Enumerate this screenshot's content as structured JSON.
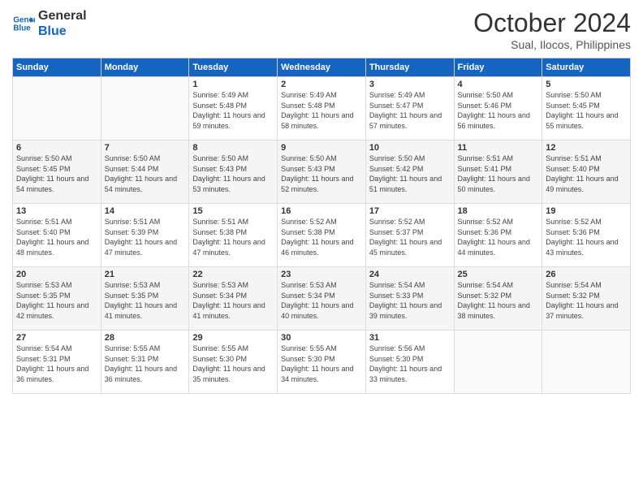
{
  "logo": {
    "line1": "General",
    "line2": "Blue"
  },
  "title": "October 2024",
  "location": "Sual, Ilocos, Philippines",
  "days_of_week": [
    "Sunday",
    "Monday",
    "Tuesday",
    "Wednesday",
    "Thursday",
    "Friday",
    "Saturday"
  ],
  "weeks": [
    [
      {
        "day": "",
        "sunrise": "",
        "sunset": "",
        "daylight": ""
      },
      {
        "day": "",
        "sunrise": "",
        "sunset": "",
        "daylight": ""
      },
      {
        "day": "1",
        "sunrise": "Sunrise: 5:49 AM",
        "sunset": "Sunset: 5:48 PM",
        "daylight": "Daylight: 11 hours and 59 minutes."
      },
      {
        "day": "2",
        "sunrise": "Sunrise: 5:49 AM",
        "sunset": "Sunset: 5:48 PM",
        "daylight": "Daylight: 11 hours and 58 minutes."
      },
      {
        "day": "3",
        "sunrise": "Sunrise: 5:49 AM",
        "sunset": "Sunset: 5:47 PM",
        "daylight": "Daylight: 11 hours and 57 minutes."
      },
      {
        "day": "4",
        "sunrise": "Sunrise: 5:50 AM",
        "sunset": "Sunset: 5:46 PM",
        "daylight": "Daylight: 11 hours and 56 minutes."
      },
      {
        "day": "5",
        "sunrise": "Sunrise: 5:50 AM",
        "sunset": "Sunset: 5:45 PM",
        "daylight": "Daylight: 11 hours and 55 minutes."
      }
    ],
    [
      {
        "day": "6",
        "sunrise": "Sunrise: 5:50 AM",
        "sunset": "Sunset: 5:45 PM",
        "daylight": "Daylight: 11 hours and 54 minutes."
      },
      {
        "day": "7",
        "sunrise": "Sunrise: 5:50 AM",
        "sunset": "Sunset: 5:44 PM",
        "daylight": "Daylight: 11 hours and 54 minutes."
      },
      {
        "day": "8",
        "sunrise": "Sunrise: 5:50 AM",
        "sunset": "Sunset: 5:43 PM",
        "daylight": "Daylight: 11 hours and 53 minutes."
      },
      {
        "day": "9",
        "sunrise": "Sunrise: 5:50 AM",
        "sunset": "Sunset: 5:43 PM",
        "daylight": "Daylight: 11 hours and 52 minutes."
      },
      {
        "day": "10",
        "sunrise": "Sunrise: 5:50 AM",
        "sunset": "Sunset: 5:42 PM",
        "daylight": "Daylight: 11 hours and 51 minutes."
      },
      {
        "day": "11",
        "sunrise": "Sunrise: 5:51 AM",
        "sunset": "Sunset: 5:41 PM",
        "daylight": "Daylight: 11 hours and 50 minutes."
      },
      {
        "day": "12",
        "sunrise": "Sunrise: 5:51 AM",
        "sunset": "Sunset: 5:40 PM",
        "daylight": "Daylight: 11 hours and 49 minutes."
      }
    ],
    [
      {
        "day": "13",
        "sunrise": "Sunrise: 5:51 AM",
        "sunset": "Sunset: 5:40 PM",
        "daylight": "Daylight: 11 hours and 48 minutes."
      },
      {
        "day": "14",
        "sunrise": "Sunrise: 5:51 AM",
        "sunset": "Sunset: 5:39 PM",
        "daylight": "Daylight: 11 hours and 47 minutes."
      },
      {
        "day": "15",
        "sunrise": "Sunrise: 5:51 AM",
        "sunset": "Sunset: 5:38 PM",
        "daylight": "Daylight: 11 hours and 47 minutes."
      },
      {
        "day": "16",
        "sunrise": "Sunrise: 5:52 AM",
        "sunset": "Sunset: 5:38 PM",
        "daylight": "Daylight: 11 hours and 46 minutes."
      },
      {
        "day": "17",
        "sunrise": "Sunrise: 5:52 AM",
        "sunset": "Sunset: 5:37 PM",
        "daylight": "Daylight: 11 hours and 45 minutes."
      },
      {
        "day": "18",
        "sunrise": "Sunrise: 5:52 AM",
        "sunset": "Sunset: 5:36 PM",
        "daylight": "Daylight: 11 hours and 44 minutes."
      },
      {
        "day": "19",
        "sunrise": "Sunrise: 5:52 AM",
        "sunset": "Sunset: 5:36 PM",
        "daylight": "Daylight: 11 hours and 43 minutes."
      }
    ],
    [
      {
        "day": "20",
        "sunrise": "Sunrise: 5:53 AM",
        "sunset": "Sunset: 5:35 PM",
        "daylight": "Daylight: 11 hours and 42 minutes."
      },
      {
        "day": "21",
        "sunrise": "Sunrise: 5:53 AM",
        "sunset": "Sunset: 5:35 PM",
        "daylight": "Daylight: 11 hours and 41 minutes."
      },
      {
        "day": "22",
        "sunrise": "Sunrise: 5:53 AM",
        "sunset": "Sunset: 5:34 PM",
        "daylight": "Daylight: 11 hours and 41 minutes."
      },
      {
        "day": "23",
        "sunrise": "Sunrise: 5:53 AM",
        "sunset": "Sunset: 5:34 PM",
        "daylight": "Daylight: 11 hours and 40 minutes."
      },
      {
        "day": "24",
        "sunrise": "Sunrise: 5:54 AM",
        "sunset": "Sunset: 5:33 PM",
        "daylight": "Daylight: 11 hours and 39 minutes."
      },
      {
        "day": "25",
        "sunrise": "Sunrise: 5:54 AM",
        "sunset": "Sunset: 5:32 PM",
        "daylight": "Daylight: 11 hours and 38 minutes."
      },
      {
        "day": "26",
        "sunrise": "Sunrise: 5:54 AM",
        "sunset": "Sunset: 5:32 PM",
        "daylight": "Daylight: 11 hours and 37 minutes."
      }
    ],
    [
      {
        "day": "27",
        "sunrise": "Sunrise: 5:54 AM",
        "sunset": "Sunset: 5:31 PM",
        "daylight": "Daylight: 11 hours and 36 minutes."
      },
      {
        "day": "28",
        "sunrise": "Sunrise: 5:55 AM",
        "sunset": "Sunset: 5:31 PM",
        "daylight": "Daylight: 11 hours and 36 minutes."
      },
      {
        "day": "29",
        "sunrise": "Sunrise: 5:55 AM",
        "sunset": "Sunset: 5:30 PM",
        "daylight": "Daylight: 11 hours and 35 minutes."
      },
      {
        "day": "30",
        "sunrise": "Sunrise: 5:55 AM",
        "sunset": "Sunset: 5:30 PM",
        "daylight": "Daylight: 11 hours and 34 minutes."
      },
      {
        "day": "31",
        "sunrise": "Sunrise: 5:56 AM",
        "sunset": "Sunset: 5:30 PM",
        "daylight": "Daylight: 11 hours and 33 minutes."
      },
      {
        "day": "",
        "sunrise": "",
        "sunset": "",
        "daylight": ""
      },
      {
        "day": "",
        "sunrise": "",
        "sunset": "",
        "daylight": ""
      }
    ]
  ]
}
